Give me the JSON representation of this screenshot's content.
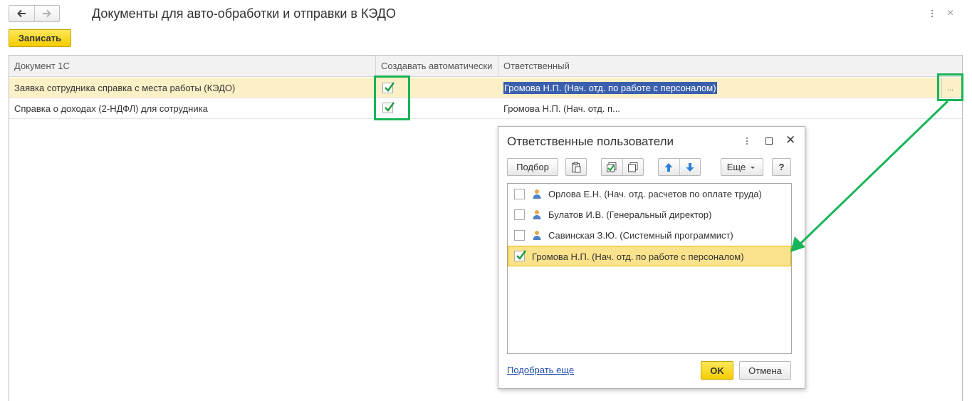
{
  "window": {
    "title": "Документы для авто-обработки и отправки в КЭДО",
    "close": "×"
  },
  "toolbar": {
    "save_label": "Записать"
  },
  "table": {
    "columns": [
      "Документ 1С",
      "Создавать автоматически",
      "Ответственный"
    ],
    "rows": [
      {
        "document": "Заявка сотрудника справка с места работы (КЭДО)",
        "auto": true,
        "responsible": "Громова Н.П. (Нач. отд. по работе с персоналом)"
      },
      {
        "document": "Справка о доходах (2-НДФЛ) для сотрудника",
        "auto": true,
        "responsible": "Громова Н.П. (Нач. отд. п..."
      }
    ],
    "choice_button": "..."
  },
  "dialog": {
    "title": "Ответственные пользователи",
    "close": "✕",
    "pick_label": "Подбор",
    "more_label": "Еще",
    "help_label": "?",
    "users": [
      {
        "name": "Орлова Е.Н. (Нач. отд. расчетов по оплате труда)",
        "checked": false
      },
      {
        "name": "Булатов И.В. (Генеральный директор)",
        "checked": false
      },
      {
        "name": "Савинская З.Ю. (Системный программист)",
        "checked": false
      },
      {
        "name": "Громова Н.П. (Нач. отд. по работе с персоналом)",
        "checked": true
      }
    ],
    "pick_more_link": "Подобрать еще",
    "ok_label": "OK",
    "cancel_label": "Отмена"
  },
  "colors": {
    "highlight": "#18b458",
    "accent_yellow": "#f5cc00",
    "selection_blue": "#3a5fae",
    "row_selected": "#fbf0c6"
  }
}
